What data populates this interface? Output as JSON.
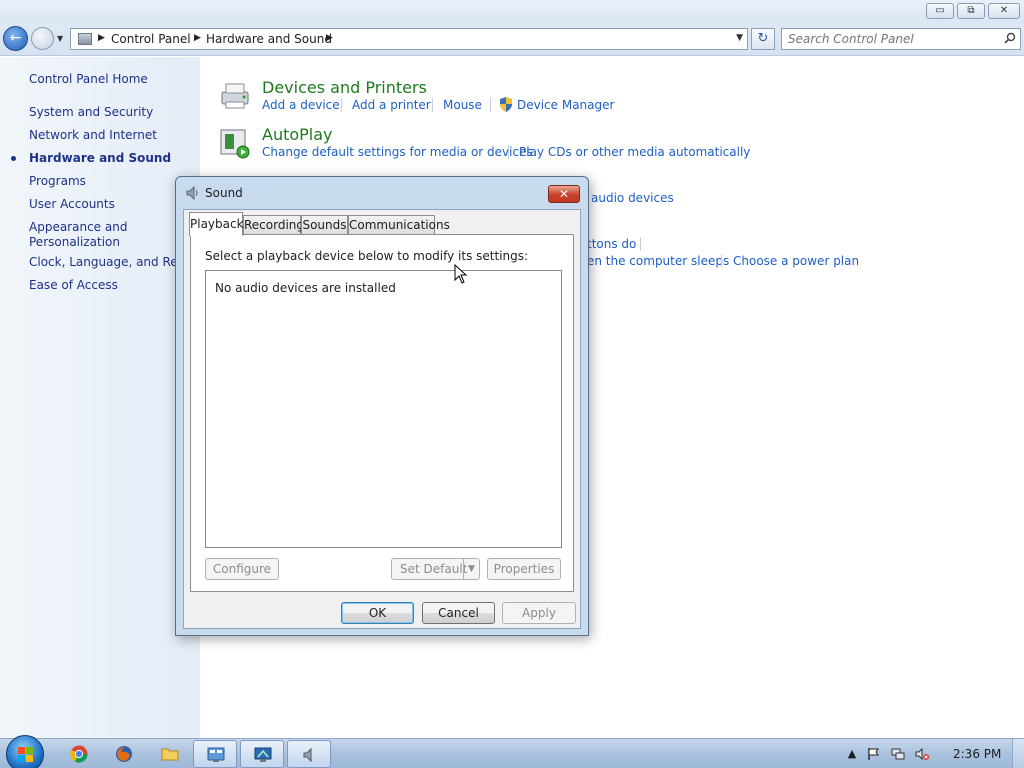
{
  "window_controls": {
    "minimize": "▭",
    "maximize": "⧉",
    "close": "✕"
  },
  "address_bar": {
    "crumbs": [
      "Control Panel",
      "Hardware and Sound"
    ],
    "search_placeholder": "Search Control Panel"
  },
  "left_nav": {
    "home": "Control Panel Home",
    "items": [
      "System and Security",
      "Network and Internet",
      "Hardware and Sound",
      "Programs",
      "User Accounts",
      "Appearance and",
      "Personalization",
      "Clock, Language, and Regio",
      "Ease of Access"
    ],
    "active": "Hardware and Sound"
  },
  "main": {
    "devices": {
      "title": "Devices and Printers",
      "links": [
        "Add a device",
        "Add a printer",
        "Mouse",
        "Device Manager"
      ]
    },
    "autoplay": {
      "title": "AutoPlay",
      "links": [
        "Change default settings for media or devices",
        "Play CDs or other media automatically"
      ]
    },
    "sound_partial": {
      "link": "audio devices"
    },
    "power_partial": {
      "links": [
        "ttons do",
        "en the computer sleeps",
        "Choose a power plan"
      ]
    }
  },
  "dialog": {
    "title": "Sound",
    "close": "✕",
    "tabs": [
      "Playback",
      "Recording",
      "Sounds",
      "Communications"
    ],
    "active_tab": "Playback",
    "instruction": "Select a playback device below to modify its settings:",
    "empty_message": "No audio devices are installed",
    "buttons": {
      "configure": "Configure",
      "set_default": "Set Default",
      "properties": "Properties",
      "ok": "OK",
      "cancel": "Cancel",
      "apply": "Apply"
    }
  },
  "taskbar": {
    "clock": "2:36 PM"
  },
  "colors": {
    "link": "#1e5fc4",
    "category_title": "#1e7a1e",
    "nav_text": "#1e3287"
  }
}
